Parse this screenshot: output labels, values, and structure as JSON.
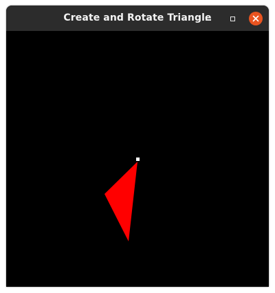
{
  "window": {
    "title": "Create and Rotate Triangle"
  },
  "controls": {
    "minimize_icon": "minimize-icon",
    "maximize_icon": "maximize-icon",
    "close_icon": "close-icon"
  },
  "colors": {
    "titlebar": "#2c2c2c",
    "canvas_background": "#000000",
    "triangle_fill": "#ff0000",
    "pivot_marker": "#ffffff",
    "close_button": "#e95420"
  }
}
